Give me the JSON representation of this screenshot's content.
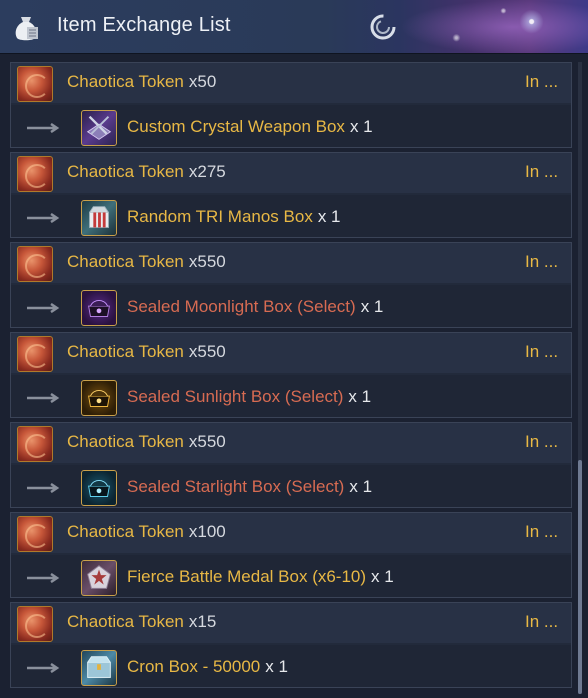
{
  "window": {
    "title": "Item Exchange List",
    "icons": {
      "title": "money-bag-icon",
      "refresh": "swirl-icon"
    }
  },
  "entries": [
    {
      "cost_item": "Chaotica Token",
      "cost_qty": "x50",
      "status": "In ...",
      "reward_item": "Custom Crystal Weapon Box",
      "reward_qty": "x 1",
      "reward_color": "gold",
      "reward_icon": "crystal-weapon-box-icon"
    },
    {
      "cost_item": "Chaotica Token",
      "cost_qty": "x275",
      "status": "In ...",
      "reward_item": "Random TRI Manos Box",
      "reward_qty": "x 1",
      "reward_color": "gold",
      "reward_icon": "tri-manos-box-icon"
    },
    {
      "cost_item": "Chaotica Token",
      "cost_qty": "x550",
      "status": "In ...",
      "reward_item": "Sealed Moonlight Box (Select)",
      "reward_qty": "x 1",
      "reward_color": "red",
      "reward_icon": "moonlight-box-icon"
    },
    {
      "cost_item": "Chaotica Token",
      "cost_qty": "x550",
      "status": "In ...",
      "reward_item": "Sealed Sunlight Box (Select)",
      "reward_qty": "x 1",
      "reward_color": "red",
      "reward_icon": "sunlight-box-icon"
    },
    {
      "cost_item": "Chaotica Token",
      "cost_qty": "x550",
      "status": "In ...",
      "reward_item": "Sealed Starlight Box (Select)",
      "reward_qty": "x 1",
      "reward_color": "red",
      "reward_icon": "starlight-box-icon"
    },
    {
      "cost_item": "Chaotica Token",
      "cost_qty": "x100",
      "status": "In ...",
      "reward_item": "Fierce Battle Medal Box (x6-10)",
      "reward_qty": "x 1",
      "reward_color": "gold",
      "reward_icon": "battle-medal-box-icon"
    },
    {
      "cost_item": "Chaotica Token",
      "cost_qty": "x15",
      "status": "In ...",
      "reward_item": "Cron Box - 50000",
      "reward_qty": "x 1",
      "reward_color": "gold",
      "reward_icon": "cron-box-icon"
    }
  ],
  "colors": {
    "gold_text": "#e8b845",
    "red_text": "#d76b52",
    "panel_bg": "#1b2131"
  }
}
